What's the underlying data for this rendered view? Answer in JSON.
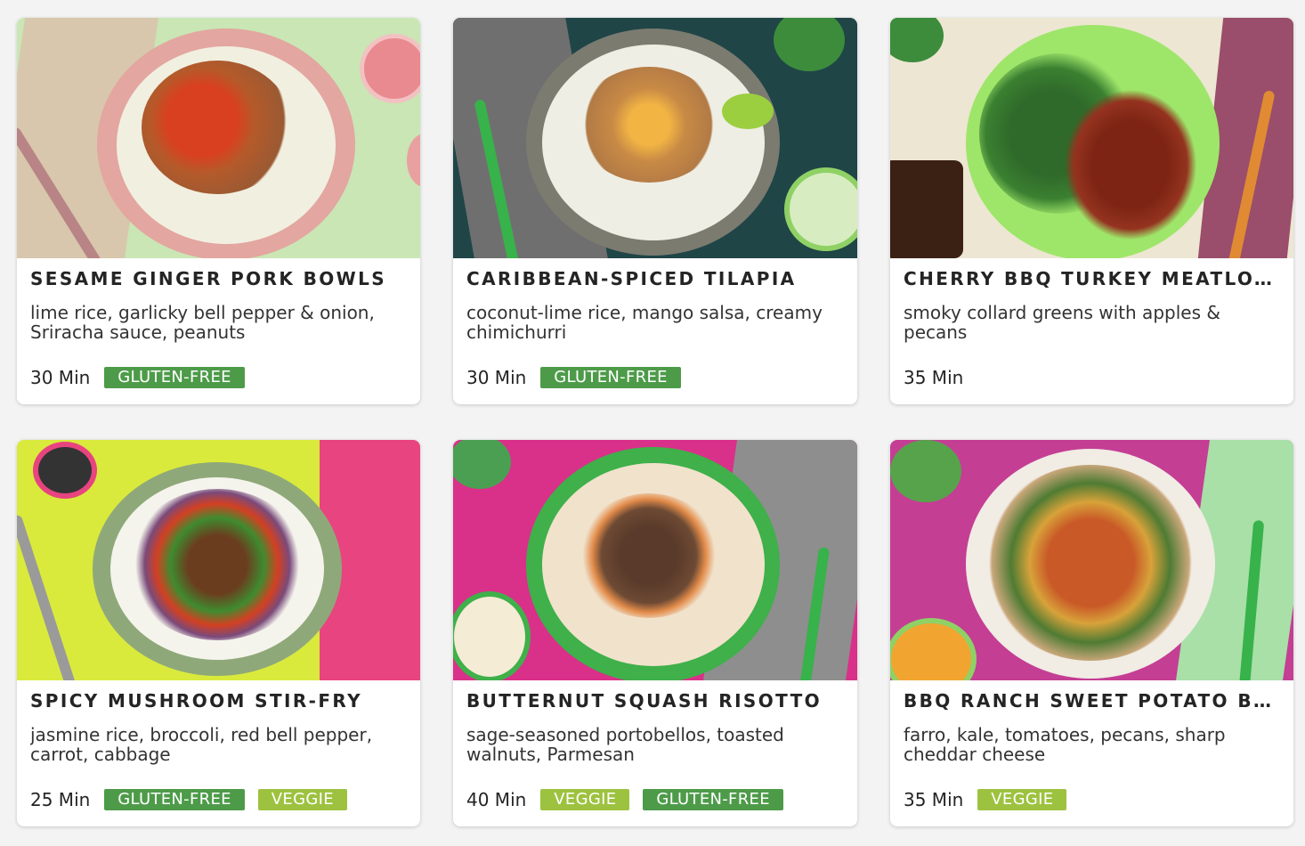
{
  "colors": {
    "card_bg": "#ffffff",
    "page_bg": "#f3f3f3",
    "title": "#242424",
    "gluten_free_tag": "#4d9b49",
    "veggie_tag": "#9dc23f"
  },
  "recipes": [
    {
      "title": "SESAME GINGER PORK BOWLS",
      "description": "lime rice, garlicky bell pepper & onion, Sriracha sauce, peanuts",
      "time": "30 Min",
      "tags": [
        "GLUTEN-FREE"
      ],
      "photo_bg": "#c9e6b4"
    },
    {
      "title": "CARIBBEAN-SPICED TILAPIA",
      "description": "coconut-lime rice, mango salsa, creamy chimichurri",
      "time": "30 Min",
      "tags": [
        "GLUTEN-FREE"
      ],
      "photo_bg": "#1f4547"
    },
    {
      "title": "CHERRY BBQ TURKEY MEATLOAF",
      "description": "smoky collard greens with apples & pecans",
      "time": "35 Min",
      "tags": [],
      "photo_bg": "#ede6d2"
    },
    {
      "title": "SPICY MUSHROOM STIR-FRY",
      "description": "jasmine rice, broccoli, red bell pepper, carrot, cabbage",
      "time": "25 Min",
      "tags": [
        "GLUTEN-FREE",
        "VEGGIE"
      ],
      "photo_bg": "#d9ea3c"
    },
    {
      "title": "BUTTERNUT SQUASH RISOTTO",
      "description": "sage-seasoned portobellos, toasted walnuts, Parmesan",
      "time": "40 Min",
      "tags": [
        "VEGGIE",
        "GLUTEN-FREE"
      ],
      "photo_bg": "#d9308a"
    },
    {
      "title": "BBQ RANCH SWEET POTATO BOWLS",
      "description": "farro, kale, tomatoes, pecans, sharp cheddar cheese",
      "time": "35 Min",
      "tags": [
        "VEGGIE"
      ],
      "photo_bg": "#c43e94"
    }
  ]
}
